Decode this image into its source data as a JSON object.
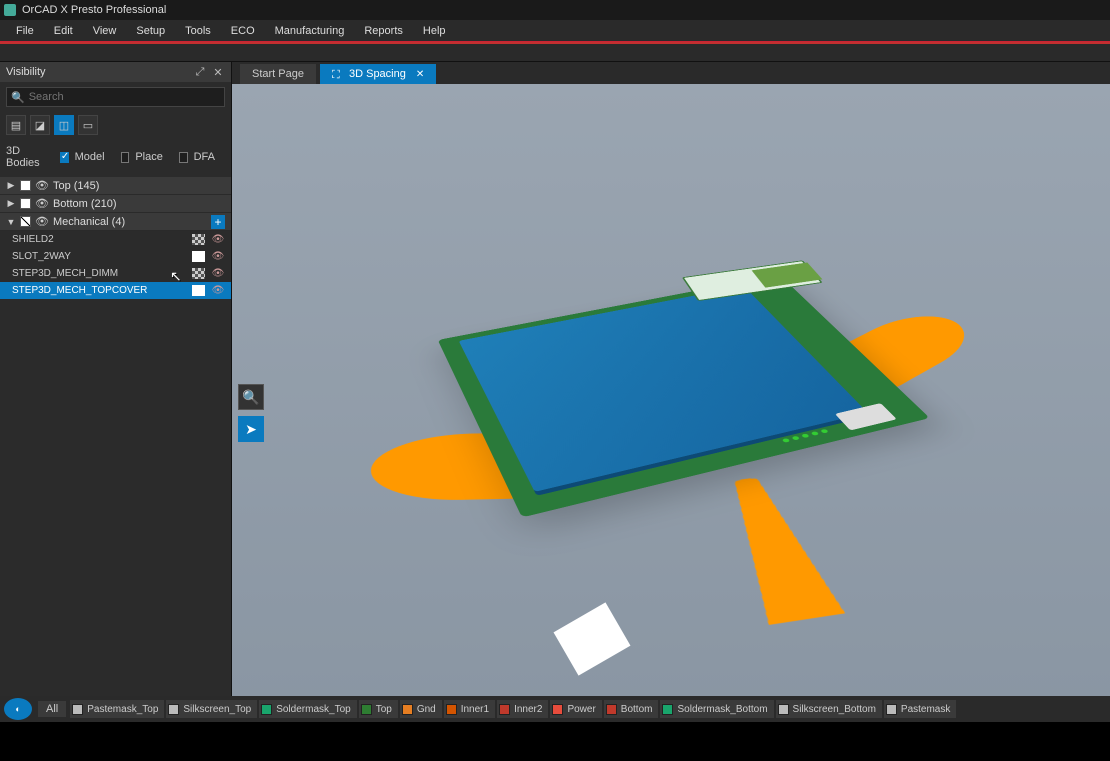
{
  "app": {
    "title": "OrCAD X Presto Professional"
  },
  "menu": [
    "File",
    "Edit",
    "View",
    "Setup",
    "Tools",
    "ECO",
    "Manufacturing",
    "Reports",
    "Help"
  ],
  "panel": {
    "title": "Visibility",
    "search_placeholder": "Search",
    "filters": {
      "bodies_label": "3D Bodies",
      "model_label": "Model",
      "place_label": "Place",
      "dfa_label": "DFA"
    },
    "groups": [
      {
        "label": "Top (145)",
        "expanded": false
      },
      {
        "label": "Bottom (210)",
        "expanded": false
      },
      {
        "label": "Mechanical (4)",
        "expanded": true
      }
    ],
    "mechanical_items": [
      {
        "label": "SHIELD2",
        "pattern": "checker",
        "selected": false
      },
      {
        "label": "SLOT_2WAY",
        "pattern": "white",
        "selected": false
      },
      {
        "label": "STEP3D_MECH_DIMM",
        "pattern": "checker",
        "selected": false
      },
      {
        "label": "STEP3D_MECH_TOPCOVER",
        "pattern": "white",
        "selected": true
      }
    ]
  },
  "tabs": [
    {
      "label": "Start Page",
      "active": false
    },
    {
      "label": "3D Spacing",
      "active": true
    }
  ],
  "layers": {
    "all_label": "All",
    "items": [
      {
        "label": "Pastemask_Top",
        "color": "#bbbbbb"
      },
      {
        "label": "Silkscreen_Top",
        "color": "#bbbbbb"
      },
      {
        "label": "Soldermask_Top",
        "color": "#19a56c"
      },
      {
        "label": "Top",
        "color": "#2e7d32"
      },
      {
        "label": "Gnd",
        "color": "#e67e22"
      },
      {
        "label": "Inner1",
        "color": "#d35400"
      },
      {
        "label": "Inner2",
        "color": "#c0392b"
      },
      {
        "label": "Power",
        "color": "#e74c3c"
      },
      {
        "label": "Bottom",
        "color": "#c0392b"
      },
      {
        "label": "Soldermask_Bottom",
        "color": "#19a56c"
      },
      {
        "label": "Silkscreen_Bottom",
        "color": "#bbbbbb"
      },
      {
        "label": "Pastemask",
        "color": "#bbbbbb"
      }
    ]
  }
}
